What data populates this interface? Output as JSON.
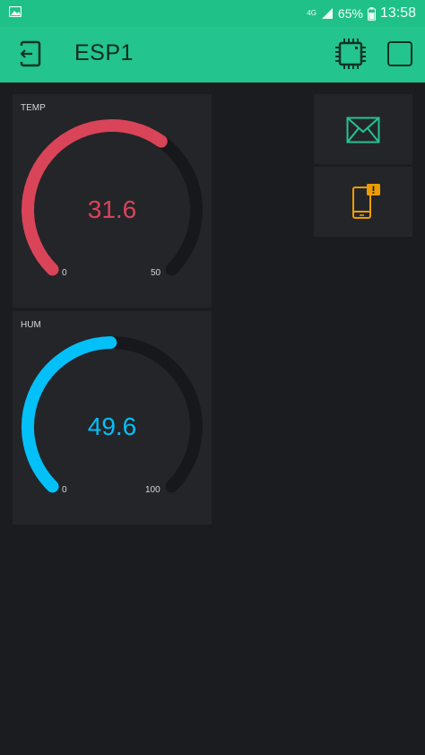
{
  "status_bar": {
    "network": "4G",
    "battery": "65%",
    "time": "13:58"
  },
  "header": {
    "title": "ESP1"
  },
  "gauges": [
    {
      "label": "TEMP",
      "value": "31.6",
      "min": "0",
      "max": "50",
      "color": "#d94459"
    },
    {
      "label": "HUM",
      "value": "49.6",
      "min": "0",
      "max": "100",
      "color": "#04c0f8"
    }
  ],
  "side_buttons": {
    "email_color": "#23c48e",
    "notification_color": "#ed9d00"
  }
}
